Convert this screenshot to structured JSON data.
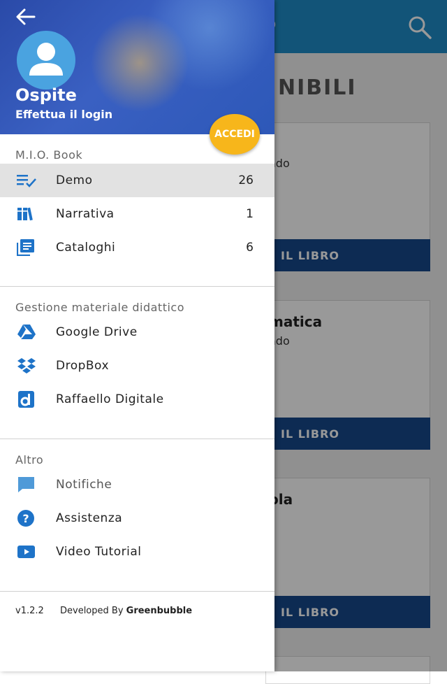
{
  "background": {
    "appbar_title_partial": "o",
    "section_title_partial": "NIBILI",
    "cards": [
      {
        "title": "",
        "subtitle": "ado",
        "button": "IL LIBRO"
      },
      {
        "title": "matica",
        "subtitle": "ado",
        "button": "IL LIBRO"
      },
      {
        "title": "ola",
        "subtitle": "",
        "button": "IL LIBRO"
      }
    ]
  },
  "drawer": {
    "header": {
      "name": "Ospite",
      "login_hint": "Effettua il login",
      "login_button": "ACCEDI"
    },
    "sections": [
      {
        "title": "M.I.O. Book",
        "items": [
          {
            "label": "Demo",
            "count": "26",
            "icon": "checklist-icon",
            "active": true
          },
          {
            "label": "Narrativa",
            "count": "1",
            "icon": "books-icon"
          },
          {
            "label": "Cataloghi",
            "count": "6",
            "icon": "catalog-icon"
          }
        ]
      },
      {
        "title": "Gestione materiale didattico",
        "items": [
          {
            "label": "Google Drive",
            "icon": "google-drive-icon"
          },
          {
            "label": "DropBox",
            "icon": "dropbox-icon"
          },
          {
            "label": "Raffaello Digitale",
            "icon": "raffaello-digitale-icon"
          }
        ]
      },
      {
        "title": "Altro",
        "items": [
          {
            "label": "Notifiche",
            "icon": "chat-icon"
          },
          {
            "label": "Assistenza",
            "icon": "help-icon"
          },
          {
            "label": "Video Tutorial",
            "icon": "play-icon"
          }
        ]
      }
    ],
    "footer": {
      "version": "v1.2.2",
      "developed_by": "Developed By ",
      "brand": "Greenbubble"
    }
  },
  "colors": {
    "appbar": "#1e8cc8",
    "accent_icons": "#1e73c8",
    "accedi": "#f7b61b",
    "card_button": "#16488a"
  }
}
